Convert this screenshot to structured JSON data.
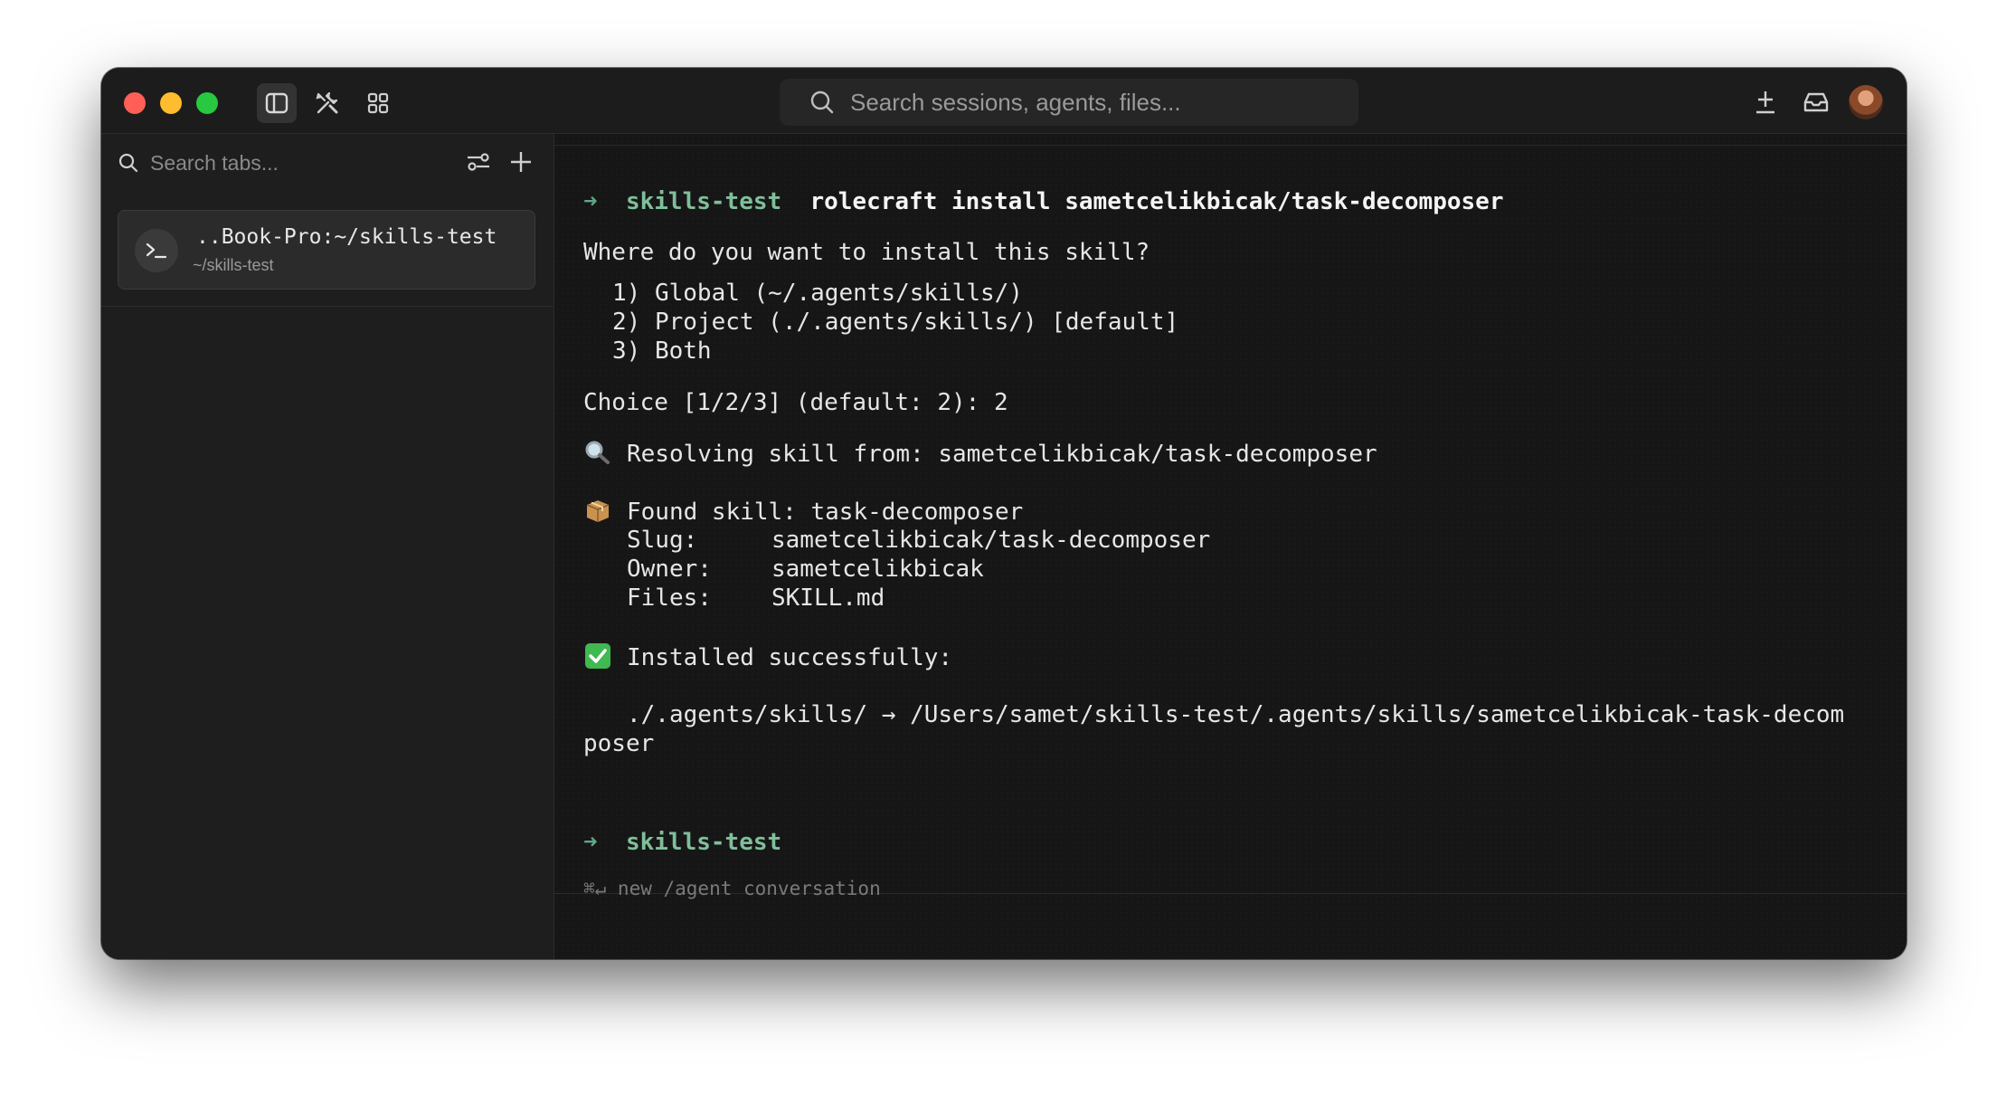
{
  "search": {
    "placeholder": "Search sessions, agents, files..."
  },
  "sidebar": {
    "search_placeholder": "Search tabs...",
    "tab": {
      "title": "..Book-Pro:~/skills-test",
      "subtitle": "~/skills-test"
    }
  },
  "terminal": {
    "prompt_arrow": "➜",
    "prompt_dir": "skills-test",
    "command": "rolecraft install sametcelikbicak/task-decomposer",
    "question": "Where do you want to install this skill?",
    "options": [
      "1) Global (~/.agents/skills/)",
      "2) Project (./.agents/skills/) [default]",
      "3) Both"
    ],
    "choice": "Choice [1/2/3] (default: 2): 2",
    "resolving": "Resolving skill from: sametcelikbicak/task-decomposer",
    "found": "Found skill: task-decomposer",
    "slug_label": "Slug:",
    "slug_value": "sametcelikbicak/task-decomposer",
    "owner_label": "Owner:",
    "owner_value": "sametcelikbicak",
    "files_label": "Files:",
    "files_value": "SKILL.md",
    "installed": "Installed successfully:",
    "install_path_line1": "./.agents/skills/ → /Users/samet/skills-test/.agents/skills/sametcelikbicak-task-decom",
    "install_path_line2": "poser",
    "next_prompt_dir": "skills-test",
    "hint": "⌘↵ new /agent conversation"
  },
  "icons": {
    "sidebar_toggle": "sidebar-icon",
    "tools": "tools-icon",
    "grid": "grid-icon",
    "search": "search-icon",
    "download": "download-icon",
    "inbox": "inbox-icon",
    "filter": "filter-icon",
    "add": "plus-icon",
    "terminal": "terminal-icon"
  },
  "colors": {
    "prompt_green": "#7fbf9a",
    "close": "#ff5f57",
    "minimize": "#febc2e",
    "maximize": "#28c840"
  }
}
